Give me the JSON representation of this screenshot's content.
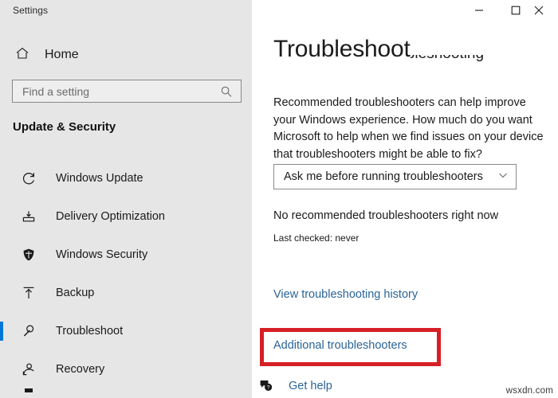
{
  "window": {
    "app_title": "Settings",
    "controls": [
      {
        "name": "minimize",
        "glyph": "minimize-icon"
      },
      {
        "name": "maximize",
        "glyph": "maximize-icon"
      },
      {
        "name": "close",
        "glyph": "close-icon"
      }
    ]
  },
  "sidebar": {
    "home_label": "Home",
    "home_icon": "home-icon",
    "search": {
      "placeholder": "Find a setting",
      "value": "",
      "icon": "search-icon"
    },
    "group_title": "Update & Security",
    "items": [
      {
        "label": "Windows Update",
        "icon": "refresh-icon",
        "selected": false
      },
      {
        "label": "Delivery Optimization",
        "icon": "delivery-icon",
        "selected": false
      },
      {
        "label": "Windows Security",
        "icon": "shield-icon",
        "selected": false
      },
      {
        "label": "Backup",
        "icon": "upload-arrow-icon",
        "selected": false
      },
      {
        "label": "Troubleshoot",
        "icon": "wrench-icon",
        "selected": true
      },
      {
        "label": "Recovery",
        "icon": "recovery-icon",
        "selected": false
      }
    ],
    "selection_color": "#0078d7",
    "background_color": "#e6e6e6"
  },
  "main": {
    "page_title": "Troubleshoot",
    "section_heading": "Recommended troubleshooting",
    "body_text": "Recommended troubleshooters can help improve your Windows experience. How much do you want Microsoft to help when we find issues on your device that troubleshooters might be able to fix?",
    "dropdown": {
      "value": "Ask me before running troubleshooters",
      "icon": "chevron-down-icon"
    },
    "status_main": "No recommended troubleshooters right now",
    "status_sub": "Last checked: never",
    "links": [
      {
        "label": "View troubleshooting history"
      },
      {
        "label": "Additional troubleshooters"
      }
    ],
    "link_color": "#2a6496",
    "highlight": {
      "target": "Additional troubleshooters",
      "color": "#d61f26"
    },
    "get_help": {
      "label": "Get help",
      "icon": "help-bubble-icon"
    }
  },
  "watermark": "wsxdn.com"
}
